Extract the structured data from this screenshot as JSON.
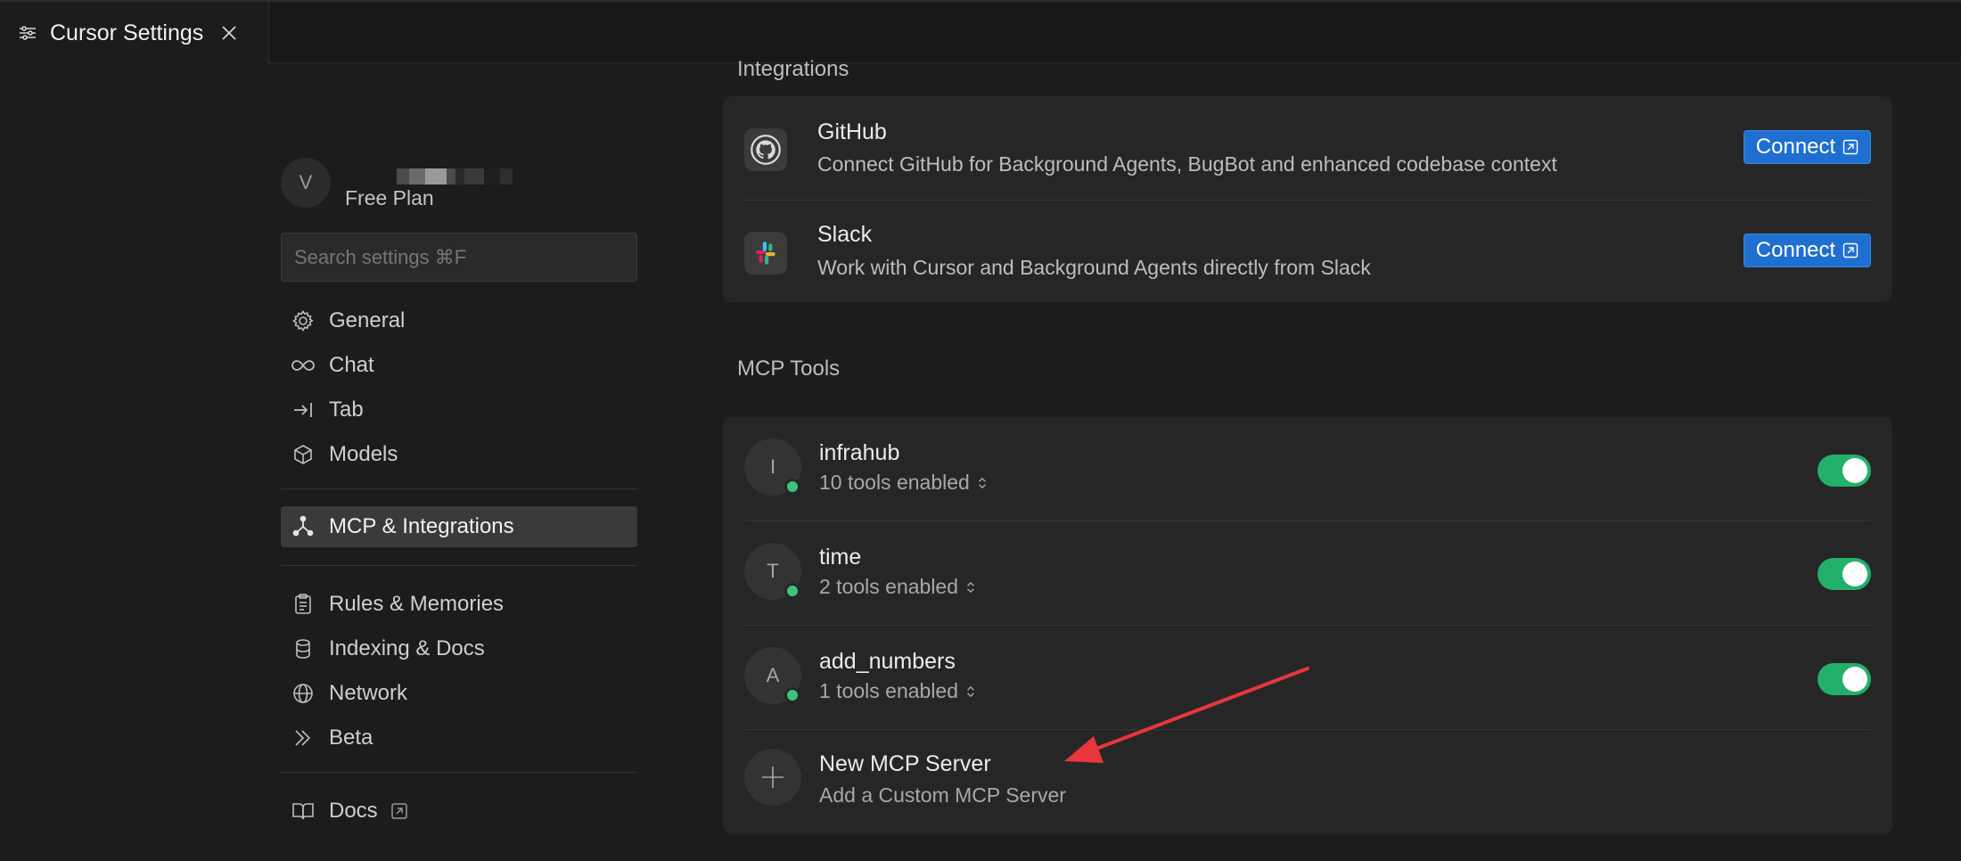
{
  "tab": {
    "title": "Cursor Settings"
  },
  "profile": {
    "initial": "V",
    "plan": "Free Plan"
  },
  "search": {
    "placeholder": "Search settings ⌘F"
  },
  "nav": [
    {
      "label": "General",
      "icon": "gear-icon"
    },
    {
      "label": "Chat",
      "icon": "infinity-icon"
    },
    {
      "label": "Tab",
      "icon": "arrow-to-line-icon"
    },
    {
      "label": "Models",
      "icon": "cube-icon"
    },
    {
      "label": "MCP & Integrations",
      "icon": "network-nodes-icon",
      "active": true
    },
    {
      "label": "Rules & Memories",
      "icon": "clipboard-icon"
    },
    {
      "label": "Indexing & Docs",
      "icon": "database-icon"
    },
    {
      "label": "Network",
      "icon": "globe-icon"
    },
    {
      "label": "Beta",
      "icon": "double-chevron-right-icon"
    },
    {
      "label": "Docs",
      "icon": "book-icon"
    }
  ],
  "integrations": {
    "title": "Integrations",
    "items": [
      {
        "name": "GitHub",
        "description": "Connect GitHub for Background Agents, BugBot and enhanced codebase context",
        "action": "Connect",
        "icon": "github-icon"
      },
      {
        "name": "Slack",
        "description": "Work with Cursor and Background Agents directly from Slack",
        "action": "Connect",
        "icon": "slack-icon"
      }
    ]
  },
  "mcp": {
    "title": "MCP Tools",
    "servers": [
      {
        "initial": "I",
        "name": "infrahub",
        "tools": "10 tools enabled",
        "enabled": true
      },
      {
        "initial": "T",
        "name": "time",
        "tools": "2 tools enabled",
        "enabled": true
      },
      {
        "initial": "A",
        "name": "add_numbers",
        "tools": "1 tools enabled",
        "enabled": true
      }
    ],
    "new_server": {
      "title": "New MCP Server",
      "subtitle": "Add a Custom MCP Server"
    }
  },
  "colors": {
    "accent_blue": "#1f6fd1",
    "toggle_green": "#22b06a",
    "status_green": "#3ec47a",
    "annotation_red": "#e8363d"
  }
}
